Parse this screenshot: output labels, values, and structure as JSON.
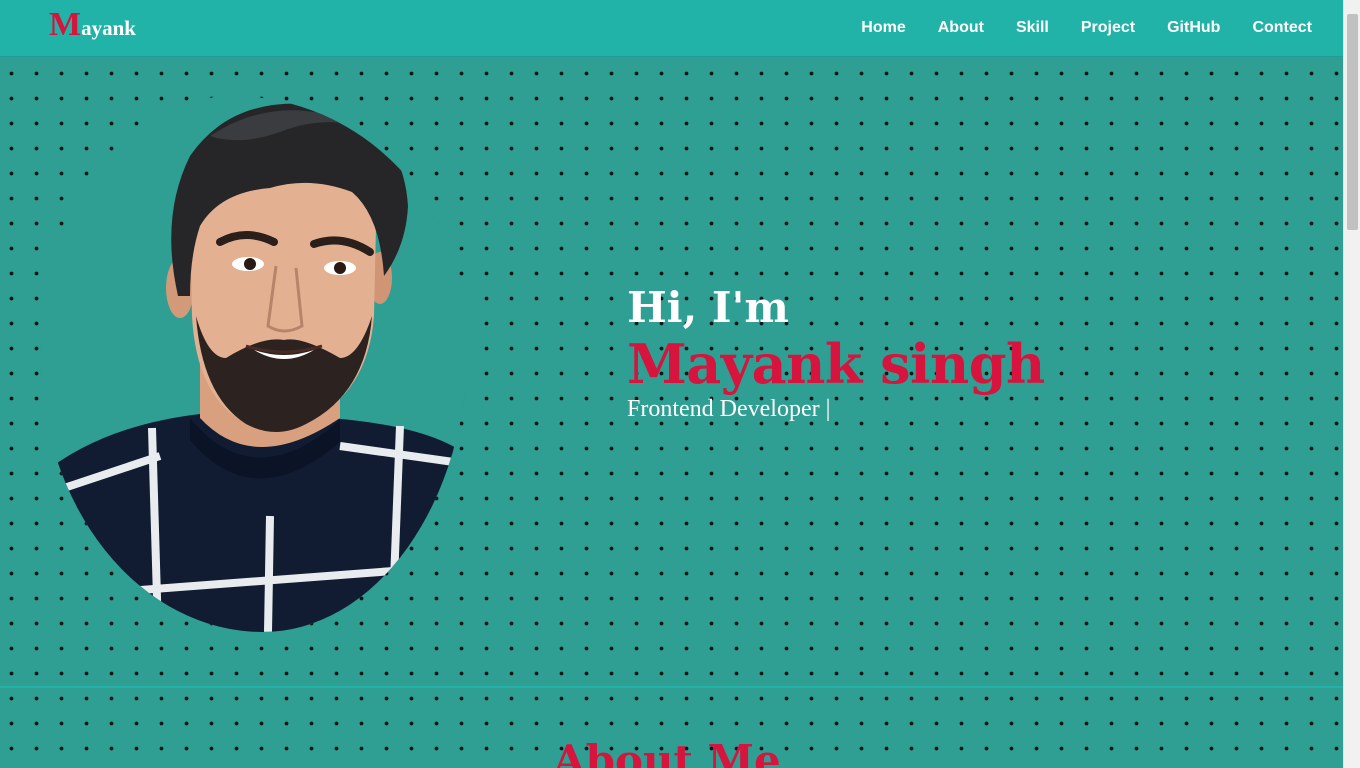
{
  "brand": {
    "first_letter": "M",
    "rest": "ayank"
  },
  "nav": {
    "items": [
      {
        "label": "Home"
      },
      {
        "label": "About"
      },
      {
        "label": "Skill"
      },
      {
        "label": "Project"
      },
      {
        "label": "GitHub"
      },
      {
        "label": "Contect"
      }
    ]
  },
  "hero": {
    "greeting": "Hi, I'm",
    "name": "Mayank singh",
    "role": "Frontend Developer |",
    "photo_icon": "profile-photo"
  },
  "about": {
    "heading": "About Me"
  },
  "colors": {
    "accent": "#d6143d",
    "navbar": "#22b3a8",
    "background": "#2f9e93",
    "dots": "#0c1414"
  },
  "scroll": {
    "position": 0
  }
}
